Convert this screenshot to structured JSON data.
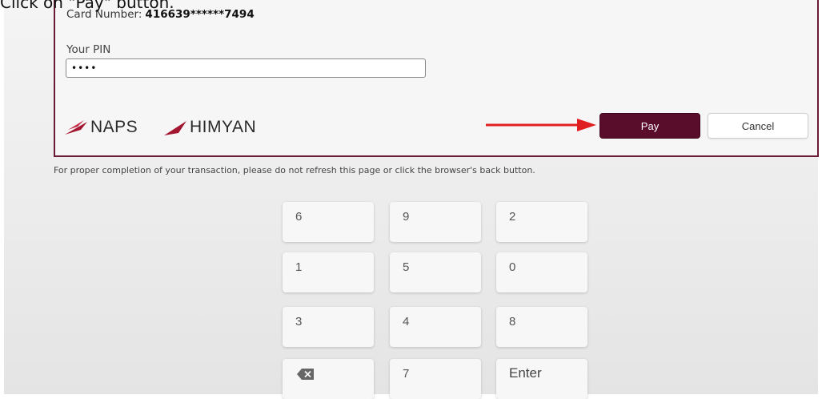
{
  "caption": "Click on \"Pay\" button.",
  "card": {
    "number_label": "Card Number:",
    "number_value": "416639******7494",
    "pin_label": "Your PIN",
    "pin_value": "••••"
  },
  "logos": [
    "NAPS",
    "HIMYAN"
  ],
  "buttons": {
    "pay": "Pay",
    "cancel": "Cancel"
  },
  "notice": "For proper completion of your transaction, please do not refresh this page or click the browser's back button.",
  "keypad": {
    "rows": [
      [
        "6",
        "9",
        "2"
      ],
      [
        "1",
        "5",
        "0"
      ],
      [
        "3",
        "4",
        "8"
      ],
      [
        "backspace-icon",
        "7",
        "Enter"
      ]
    ]
  },
  "colors": {
    "accent": "#5a0d2b",
    "card_border": "#6a1b33",
    "arrow": "#e02020",
    "logo_mark": "#a3162f"
  }
}
